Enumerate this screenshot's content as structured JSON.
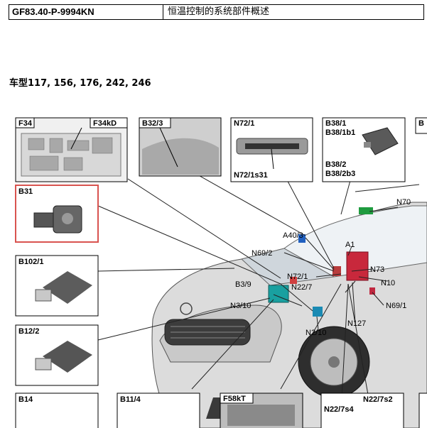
{
  "header": {
    "code": "GF83.40-P-9994KN",
    "title": "恒温控制的系统部件概述"
  },
  "model_line": "车型117, 156, 176, 242, 246",
  "labels": {
    "F34": "F34",
    "F34kD": "F34kD",
    "B32_3": "B32/3",
    "N72_1": "N72/1",
    "N72_1s31": "N72/1s31",
    "B38_1": "B38/1",
    "B38_1b1": "B38/1b1",
    "B38_2": "B38/2",
    "B38_2b3": "B38/2b3",
    "B_edge": "B",
    "B31": "B31",
    "B102_1": "B102/1",
    "B12_2": "B12/2",
    "B14": "B14",
    "B11_4": "B11/4",
    "F58kT": "F58kT",
    "N22_7s2": "N22/7s2",
    "N22_7s4": "N22/7s4",
    "N70": "N70",
    "A40_3": "A40/3",
    "A1": "A1",
    "N69_2": "N69/2",
    "N72_1c": "N72/1",
    "N73": "N73",
    "B3_9": "B3/9",
    "N22_7": "N22/7",
    "N10": "N10",
    "N3_10": "N3/10",
    "N69_1": "N69/1",
    "N127": "N127",
    "N2_10": "N2/10"
  }
}
